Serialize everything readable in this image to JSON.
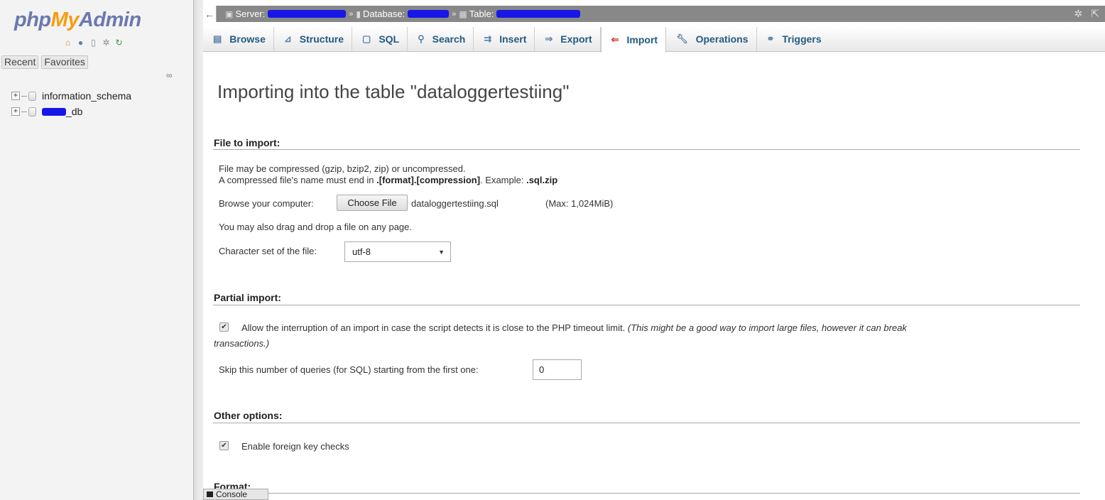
{
  "sidebar": {
    "logo": {
      "php": "php",
      "my": "My",
      "admin": "Admin"
    },
    "nav_icons": [
      "home-icon",
      "logout-icon",
      "docs-icon",
      "settings-icon",
      "reload-icon"
    ],
    "recent_label": "Recent",
    "favorites_label": "Favorites",
    "databases": [
      {
        "name": "information_schema",
        "redacted_prefix": false
      },
      {
        "name": "_db",
        "redacted_prefix": true
      }
    ]
  },
  "breadcrumb": {
    "server_label": "Server:",
    "database_label": "Database:",
    "table_label": "Table:",
    "separator": "»"
  },
  "tabs": [
    {
      "label": "Browse",
      "icon": "browse-icon",
      "active": false
    },
    {
      "label": "Structure",
      "icon": "structure-icon",
      "active": false
    },
    {
      "label": "SQL",
      "icon": "sql-icon",
      "active": false
    },
    {
      "label": "Search",
      "icon": "search-icon",
      "active": false
    },
    {
      "label": "Insert",
      "icon": "insert-icon",
      "active": false
    },
    {
      "label": "Export",
      "icon": "export-icon",
      "active": false
    },
    {
      "label": "Import",
      "icon": "import-icon",
      "active": true
    },
    {
      "label": "Operations",
      "icon": "operations-icon",
      "active": false
    },
    {
      "label": "Triggers",
      "icon": "triggers-icon",
      "active": false
    }
  ],
  "main": {
    "title": "Importing into the table \"dataloggertestiing\"",
    "file_section": {
      "heading": "File to import:",
      "compress_note": "File may be compressed (gzip, bzip2, zip) or uncompressed.",
      "name_note_prefix": "A compressed file's name must end in ",
      "name_note_format": ".[format].[compression]",
      "name_note_mid": ". Example: ",
      "name_note_example": ".sql.zip",
      "browse_label": "Browse your computer:",
      "choose_file_button": "Choose File",
      "chosen_file": "dataloggertestiing.sql",
      "max_size": "(Max: 1,024MiB)",
      "drag_note": "You may also drag and drop a file on any page.",
      "charset_label": "Character set of the file:",
      "charset_value": "utf-8"
    },
    "partial_section": {
      "heading": "Partial import:",
      "allow_interrupt_checked": true,
      "allow_interrupt_label": "Allow the interruption of an import in case the script detects it is close to the PHP timeout limit.",
      "allow_interrupt_hint_line1": "(This might be a good way to import large files, however it can break",
      "allow_interrupt_hint_line2": "transactions.)",
      "skip_label": "Skip this number of queries (for SQL) starting from the first one:",
      "skip_value": "0"
    },
    "other_section": {
      "heading": "Other options:",
      "foreign_keys_checked": true,
      "foreign_keys_label": "Enable foreign key checks"
    },
    "format_section": {
      "heading": "Format:"
    }
  },
  "console": {
    "label": "Console"
  },
  "colors": {
    "logo_blue": "#6c78af",
    "logo_orange": "#f89c0e",
    "tab_text": "#235a81",
    "breadcrumb_bg": "#888888",
    "redaction": "#1717e8"
  }
}
